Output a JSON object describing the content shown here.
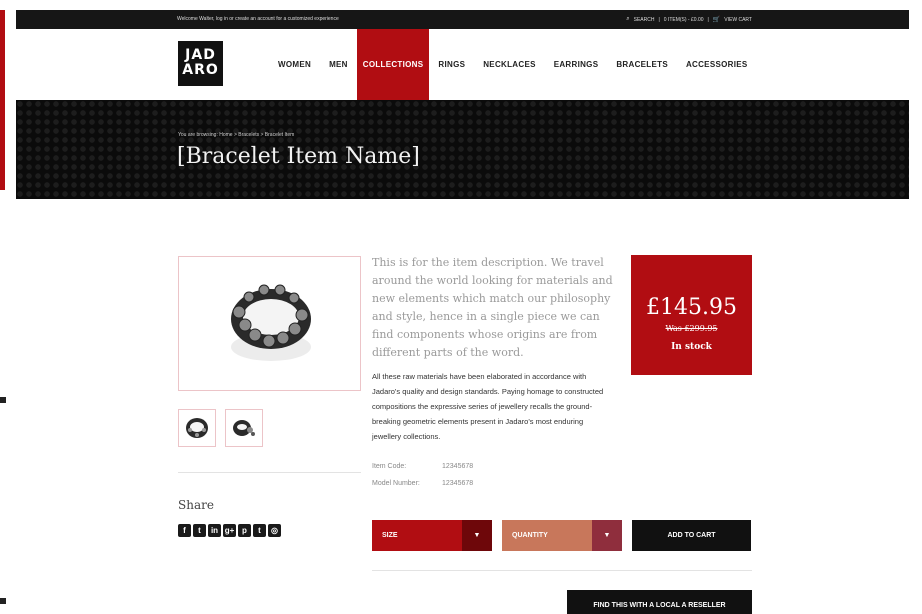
{
  "topbar": {
    "welcome": "Welcome Walter, log in or create an account for a customized experience",
    "search": "SEARCH",
    "items_count": "0 ITEM(S) - £0.00",
    "view_cart": "VIEW CART"
  },
  "header": {
    "logo_line1": "JAD",
    "logo_line2": "ARO",
    "nav": [
      {
        "label": "WOMEN"
      },
      {
        "label": "MEN"
      },
      {
        "label": "COLLECTIONS"
      },
      {
        "label": "RINGS"
      },
      {
        "label": "NECKLACES"
      },
      {
        "label": "EARRINGS"
      },
      {
        "label": "BRACELETS"
      },
      {
        "label": "ACCESSORIES"
      }
    ],
    "active_nav": "COLLECTIONS"
  },
  "hero": {
    "breadcrumb": "You are browsing: Home > Bracelets > Bracelet Item",
    "title": "[Bracelet Item Name]"
  },
  "product": {
    "lead": "This is for the item description. We travel around the world looking for materials and new elements which match our philosophy and style, hence in a single piece we can find components whose origins are from different parts of the word.",
    "body": "All these raw materials have been elaborated in accordance with Jadaro's quality and design standards. Paying homage to constructed compositions the expressive series of jewellery recalls the ground-breaking geometric elements present in Jadaro's most enduring jewellery collections.",
    "specs": [
      {
        "key": "Item Code:",
        "value": "12345678"
      },
      {
        "key": "Model Number:",
        "value": "12345678"
      }
    ]
  },
  "price": {
    "current": "£145.95",
    "was": "Was £299.95",
    "stock": "In stock"
  },
  "share": {
    "title": "Share",
    "icons": [
      "facebook-icon",
      "twitter-icon",
      "linkedin-icon",
      "googleplus-icon",
      "pinterest-icon",
      "tumblr-icon",
      "instagram-icon"
    ],
    "glyphs": [
      "f",
      "t",
      "in",
      "g+",
      "p",
      "t",
      "◎"
    ]
  },
  "controls": {
    "size": "SIZE",
    "quantity": "QUANTITY",
    "add_to_cart": "ADD TO CART",
    "reseller": "FIND THIS WITH A LOCAL A RESELLER"
  },
  "colors": {
    "brand_red": "#b10d12",
    "dark": "#111111",
    "quantity_bg": "#c8775b"
  }
}
